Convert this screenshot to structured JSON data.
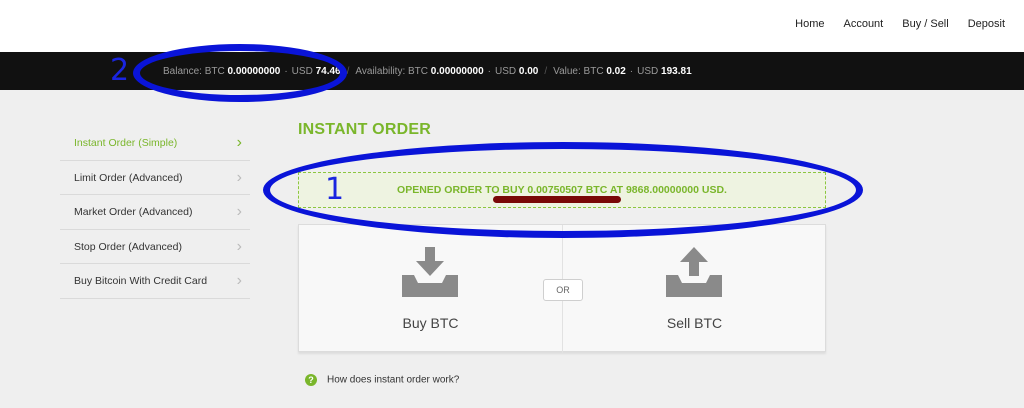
{
  "nav": {
    "home": "Home",
    "account": "Account",
    "buy_sell": "Buy / Sell",
    "deposit": "Deposit"
  },
  "balance_bar": {
    "balance_label": "Balance:",
    "balance_btc_label": "BTC",
    "balance_btc": "0.00000000",
    "balance_usd_label": "USD",
    "balance_usd": "74.46",
    "availability_label": "Availability:",
    "avail_btc_label": "BTC",
    "avail_btc": "0.00000000",
    "avail_usd_label": "USD",
    "avail_usd": "0.00",
    "value_label": "Value:",
    "value_btc_label": "BTC",
    "value_btc": "0.02",
    "value_usd_label": "USD",
    "value_usd": "193.81"
  },
  "sidebar": {
    "items": [
      {
        "label": "Instant Order (Simple)",
        "active": true
      },
      {
        "label": "Limit Order (Advanced)",
        "active": false
      },
      {
        "label": "Market Order (Advanced)",
        "active": false
      },
      {
        "label": "Stop Order (Advanced)",
        "active": false
      },
      {
        "label": "Buy Bitcoin With Credit Card",
        "active": false
      }
    ]
  },
  "main": {
    "title": "INSTANT ORDER",
    "notice": "OPENED ORDER TO BUY 0.00750507 BTC AT 9868.00000000 USD.",
    "buy_label": "Buy BTC",
    "or_label": "OR",
    "sell_label": "Sell BTC",
    "help_icon": "?",
    "help_text": "How does instant order work?"
  },
  "annotations": {
    "marker_1": "1",
    "marker_2": "2",
    "color": "#0a14d8",
    "underline_color": "#7a0808"
  },
  "colors": {
    "accent": "#7ab62b",
    "bar": "#111111"
  }
}
